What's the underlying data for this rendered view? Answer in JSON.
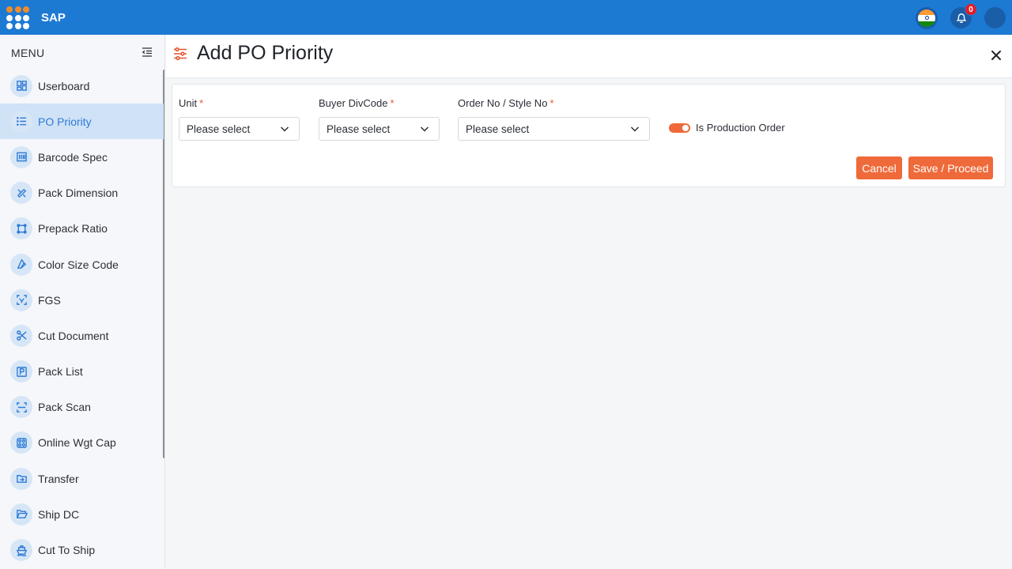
{
  "app": {
    "brand": "SAP",
    "notification_count": "0"
  },
  "colors": {
    "accent": "#1d7ad3",
    "primary_action": "#ef6a3a",
    "active_nav_bg": "#cfe2f6",
    "active_nav_text": "#2f7bd6",
    "required": "#e4572e"
  },
  "sidebar": {
    "menu_label": "MENU",
    "items": [
      {
        "label": "Userboard",
        "icon": "dashboard-icon"
      },
      {
        "label": "PO Priority",
        "icon": "list-icon",
        "active": true
      },
      {
        "label": "Barcode Spec",
        "icon": "barcode-icon"
      },
      {
        "label": "Pack Dimension",
        "icon": "ruler-icon"
      },
      {
        "label": "Prepack Ratio",
        "icon": "frame-icon"
      },
      {
        "label": "Color Size Code",
        "icon": "palette-icon"
      },
      {
        "label": "FGS",
        "icon": "scan-icon"
      },
      {
        "label": "Cut Document",
        "icon": "scissors-icon"
      },
      {
        "label": "Pack List",
        "icon": "parking-icon"
      },
      {
        "label": "Pack Scan",
        "icon": "scan-frame-icon"
      },
      {
        "label": "Online Wgt Cap",
        "icon": "weight-icon"
      },
      {
        "label": "Transfer",
        "icon": "transfer-icon"
      },
      {
        "label": "Ship DC",
        "icon": "folder-open-icon"
      },
      {
        "label": "Cut To Ship",
        "icon": "ship-icon"
      }
    ]
  },
  "page": {
    "title": "Add PO Priority",
    "form": {
      "unit": {
        "label": "Unit",
        "required_mark": "*",
        "value": "Please select"
      },
      "buyer": {
        "label": "Buyer DivCode",
        "required_mark": "*",
        "value": "Please select"
      },
      "order": {
        "label": "Order No / Style No",
        "required_mark": "*",
        "value": "Please select"
      },
      "production_toggle": {
        "label": "Is Production Order",
        "checked": true
      }
    },
    "actions": {
      "cancel": "Cancel",
      "save": "Save / Proceed"
    }
  }
}
